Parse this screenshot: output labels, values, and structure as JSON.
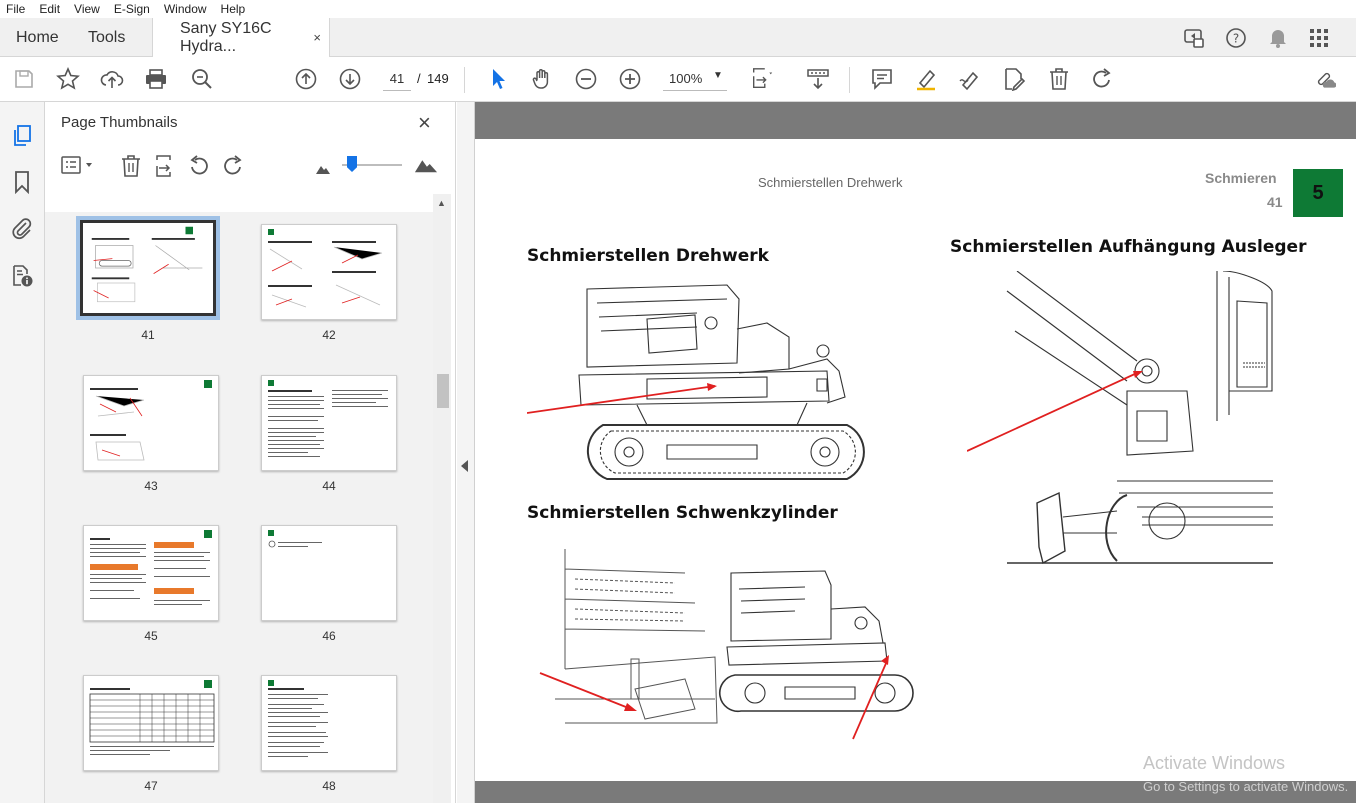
{
  "menu": [
    "File",
    "Edit",
    "View",
    "E-Sign",
    "Window",
    "Help"
  ],
  "tabs": {
    "home": "Home",
    "tools": "Tools",
    "document": "Sany SY16C Hydra...",
    "close": "×"
  },
  "toolbar": {
    "current_page": "41",
    "page_separator": "/",
    "total_pages": "149",
    "zoom": "100%"
  },
  "panel": {
    "title": "Page Thumbnails",
    "close": "×"
  },
  "thumbnails": [
    {
      "label": "41",
      "selected": true
    },
    {
      "label": "42",
      "selected": false
    },
    {
      "label": "43",
      "selected": false
    },
    {
      "label": "44",
      "selected": false
    },
    {
      "label": "45",
      "selected": false
    },
    {
      "label": "46",
      "selected": false
    },
    {
      "label": "47",
      "selected": false
    },
    {
      "label": "48",
      "selected": false
    }
  ],
  "document_page": {
    "header_center": "Schmierstellen Drehwerk",
    "section_title": "Schmieren",
    "page_number": "41",
    "chapter_number": "5",
    "chapter_color": "#0e7a35",
    "heading_1": "Schmierstellen Drehwerk",
    "heading_2": "Schmierstellen Aufhängung Ausleger",
    "heading_3": "Schmierstellen Schwenkzylinder",
    "arrow_color": "#e02020"
  },
  "watermark": {
    "line1": "Activate Windows",
    "line2": "Go to Settings to activate Windows."
  }
}
